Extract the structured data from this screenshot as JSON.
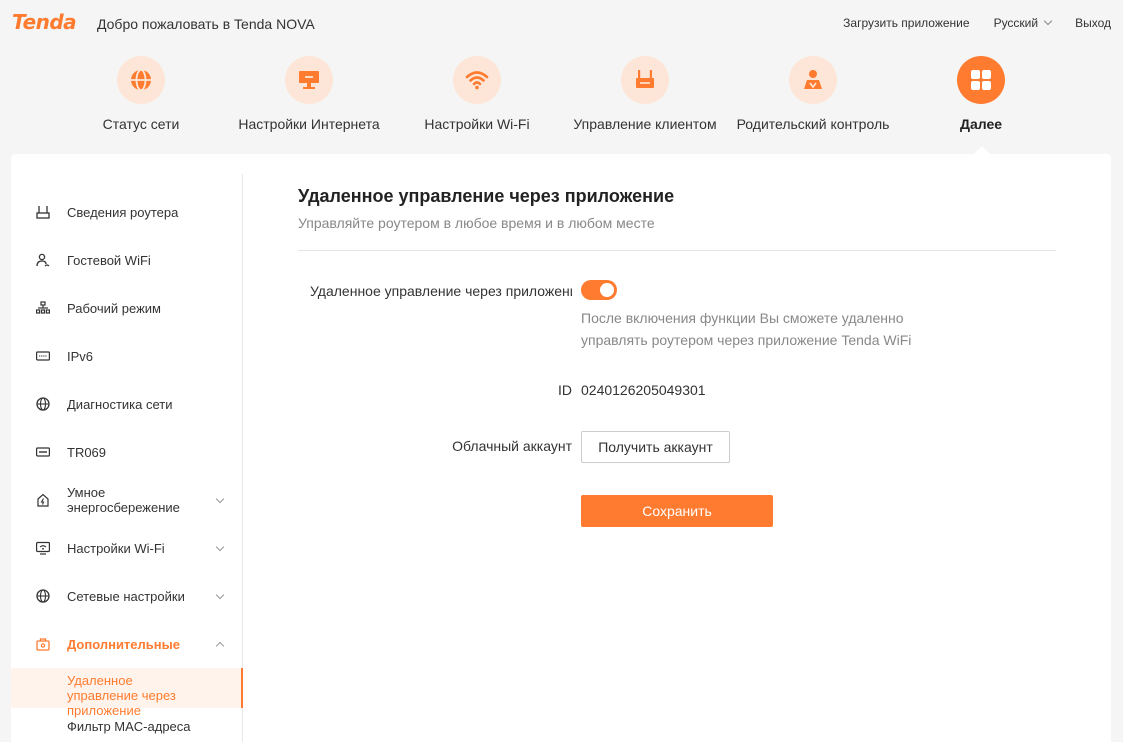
{
  "header": {
    "logo": "Tenda",
    "welcome": "Добро пожаловать в Tenda NOVA",
    "download_app": "Загрузить приложение",
    "language": "Русский",
    "logout": "Выход"
  },
  "nav": {
    "items": [
      {
        "label": "Статус сети",
        "icon": "globe-icon"
      },
      {
        "label": "Настройки Интернета",
        "icon": "monitor-icon"
      },
      {
        "label": "Настройки Wi-Fi",
        "icon": "wifi-icon"
      },
      {
        "label": "Управление клиентом",
        "icon": "router-icon"
      },
      {
        "label": "Родительский контроль",
        "icon": "parent-icon"
      },
      {
        "label": "Далее",
        "icon": "grid-icon",
        "active": true
      }
    ]
  },
  "sidebar": {
    "items": [
      {
        "label": "Сведения роутера",
        "icon": "router-small-icon"
      },
      {
        "label": "Гостевой WiFi",
        "icon": "guest-icon"
      },
      {
        "label": "Рабочий режим",
        "icon": "sitemap-icon"
      },
      {
        "label": "IPv6",
        "icon": "ipv6-icon"
      },
      {
        "label": "Диагностика сети",
        "icon": "globe-small-icon"
      },
      {
        "label": "TR069",
        "icon": "tr069-icon"
      },
      {
        "label": "Умное энергосбережение",
        "icon": "energy-icon"
      },
      {
        "label": "Настройки Wi-Fi",
        "icon": "wifi-settings-icon"
      },
      {
        "label": "Сетевые настройки",
        "icon": "network-icon"
      },
      {
        "label": "Дополнительные",
        "icon": "advanced-icon"
      }
    ],
    "subitems": [
      {
        "label": "Удаленное управление через приложение",
        "active": true
      },
      {
        "label": "Фильтр MAC-адреса"
      }
    ]
  },
  "content": {
    "title": "Удаленное управление через приложение",
    "subtitle": "Управляйте роутером в любое время и в любом месте",
    "remote_label": "Удаленное управление через приложение",
    "remote_enabled": true,
    "hint": "После включения функции Вы сможете удаленно управлять роутером через приложение Tenda WiFi",
    "id_label": "ID",
    "id_value": "0240126205049301",
    "cloud_label": "Облачный аккаунт",
    "get_account": "Получить аккаунт",
    "save": "Сохранить"
  },
  "colors": {
    "accent": "#ff7b2f",
    "accent_light": "#fde6d7",
    "page_bg": "#f5f5f5"
  }
}
